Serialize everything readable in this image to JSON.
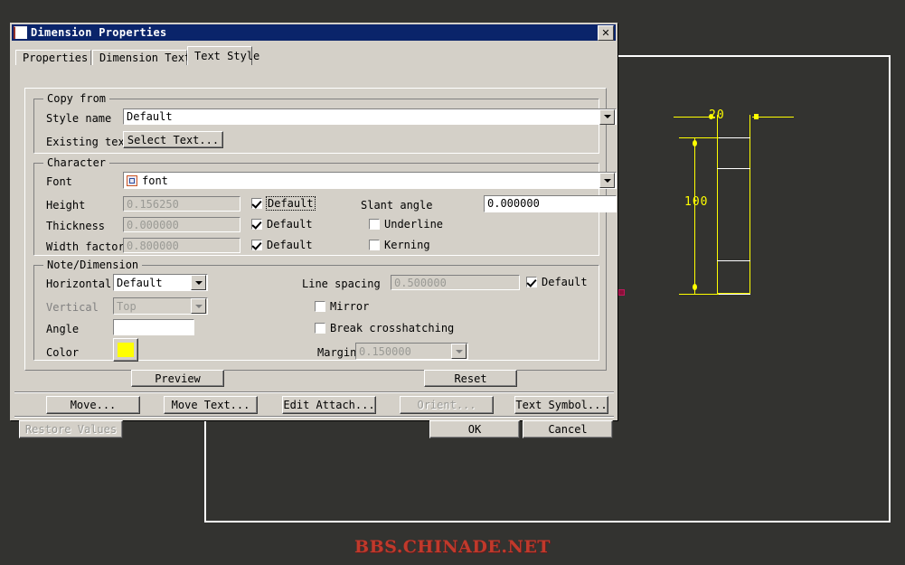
{
  "window": {
    "title": "Dimension Properties",
    "close_label": "✕",
    "icon": "document-icon"
  },
  "tabs": [
    {
      "label": "Properties",
      "active": false
    },
    {
      "label": "Dimension Text",
      "active": false
    },
    {
      "label": "Text Style",
      "active": true
    }
  ],
  "groups": {
    "copy_from": {
      "title": "Copy from",
      "style_name_label": "Style name",
      "style_name_value": "Default",
      "existing_text_label": "Existing text",
      "select_text_button": "Select Text..."
    },
    "character": {
      "title": "Character",
      "font_label": "Font",
      "font_value": "font",
      "height_label": "Height",
      "height_value": "0.156250",
      "height_default_label": "Default",
      "height_default_checked": true,
      "thickness_label": "Thickness",
      "thickness_value": "0.000000",
      "thickness_default_label": "Default",
      "thickness_default_checked": true,
      "width_factor_label": "Width factor",
      "width_factor_value": "0.800000",
      "width_factor_default_label": "Default",
      "width_factor_default_checked": true,
      "slant_angle_label": "Slant angle",
      "slant_angle_value": "0.000000",
      "underline_label": "Underline",
      "underline_checked": false,
      "kerning_label": "Kerning",
      "kerning_checked": false
    },
    "note_dimension": {
      "title": "Note/Dimension",
      "horizontal_label": "Horizontal",
      "horizontal_value": "Default",
      "vertical_label": "Vertical",
      "vertical_value": "Top",
      "angle_label": "Angle",
      "angle_value": "",
      "color_label": "Color",
      "color_value": "#FFFF00",
      "line_spacing_label": "Line spacing",
      "line_spacing_value": "0.500000",
      "line_spacing_default_label": "Default",
      "line_spacing_default_checked": true,
      "mirror_label": "Mirror",
      "mirror_checked": false,
      "break_crosshatching_label": "Break crosshatching",
      "break_crosshatching_checked": false,
      "margin_label": "Margin",
      "margin_value": "0.150000"
    }
  },
  "buttons": {
    "preview": "Preview",
    "reset": "Reset",
    "move": "Move...",
    "move_text": "Move Text...",
    "edit_attach": "Edit Attach...",
    "orient": "Orient...",
    "text_symbol": "Text Symbol...",
    "restore_values": "Restore Values",
    "ok": "OK",
    "cancel": "Cancel"
  },
  "cad": {
    "dim_width": "20",
    "dim_height": "100",
    "line_color": "#FFFF00",
    "edge_color": "#FFFFFF",
    "background": "#333330",
    "marker_color": "#8A1038"
  },
  "watermark": "BBS.CHINADE.NET"
}
